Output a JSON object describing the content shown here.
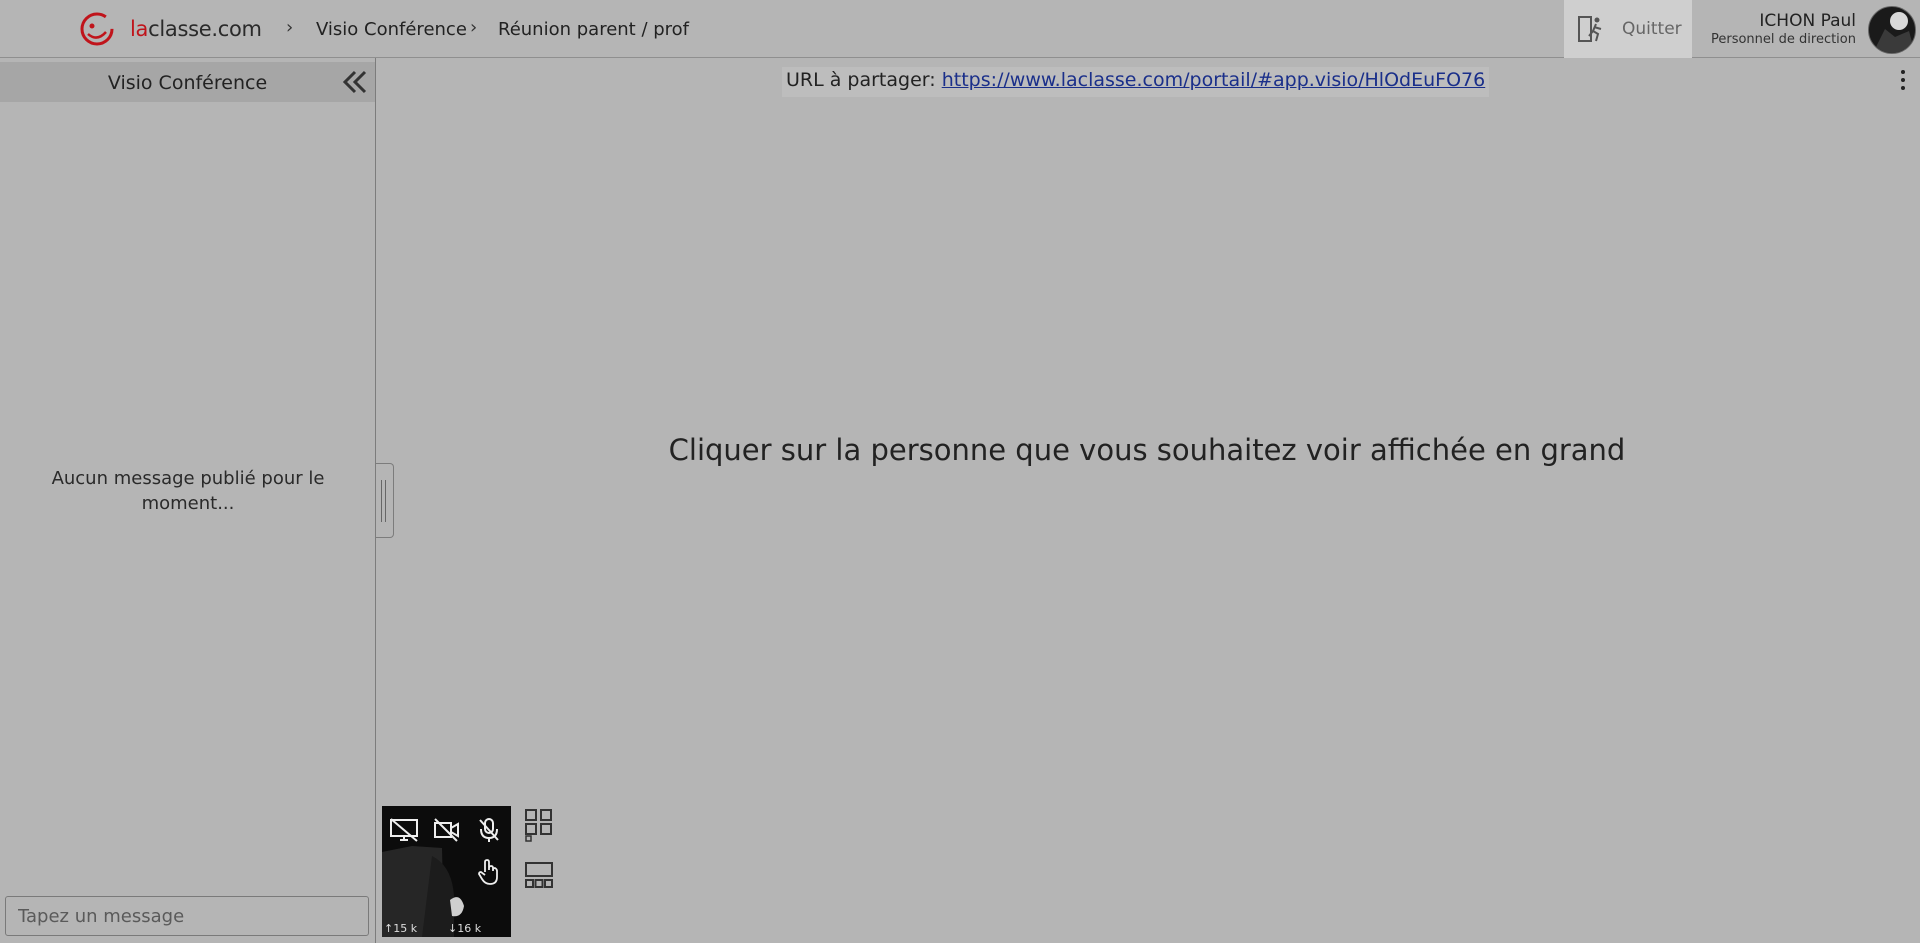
{
  "header": {
    "brand_la": "la",
    "brand_rest": "classe.com",
    "breadcrumbs": [
      "Visio Conférence",
      "Réunion parent / prof"
    ],
    "quit_label": "Quitter",
    "user_name": "ICHON Paul",
    "user_role": "Personnel de direction"
  },
  "sidebar": {
    "title": "Visio Conférence",
    "empty_message": "Aucun message publié pour le moment...",
    "input_placeholder": "Tapez un message"
  },
  "main": {
    "share_label": "URL à partager:",
    "share_url": "https://www.laclasse.com/portail/#app.visio/HlOdEuFO76",
    "instruction": "Cliquer sur la personne que vous souhaitez voir affichée en grand"
  },
  "video": {
    "up_stat": "↑15 k",
    "down_stat": "↓16 k"
  },
  "icons": [
    "logo-icon",
    "chevron-right-icon",
    "exit-icon",
    "double-chevron-left-icon",
    "kebab-menu-icon",
    "screen-share-off-icon",
    "camera-off-icon",
    "mic-off-icon",
    "hand-raise-icon",
    "grid-layout-icon",
    "strip-layout-icon"
  ],
  "colors": {
    "brand_red": "#c0141b",
    "link": "#1a2f8a",
    "background": "#b5b5b5"
  }
}
